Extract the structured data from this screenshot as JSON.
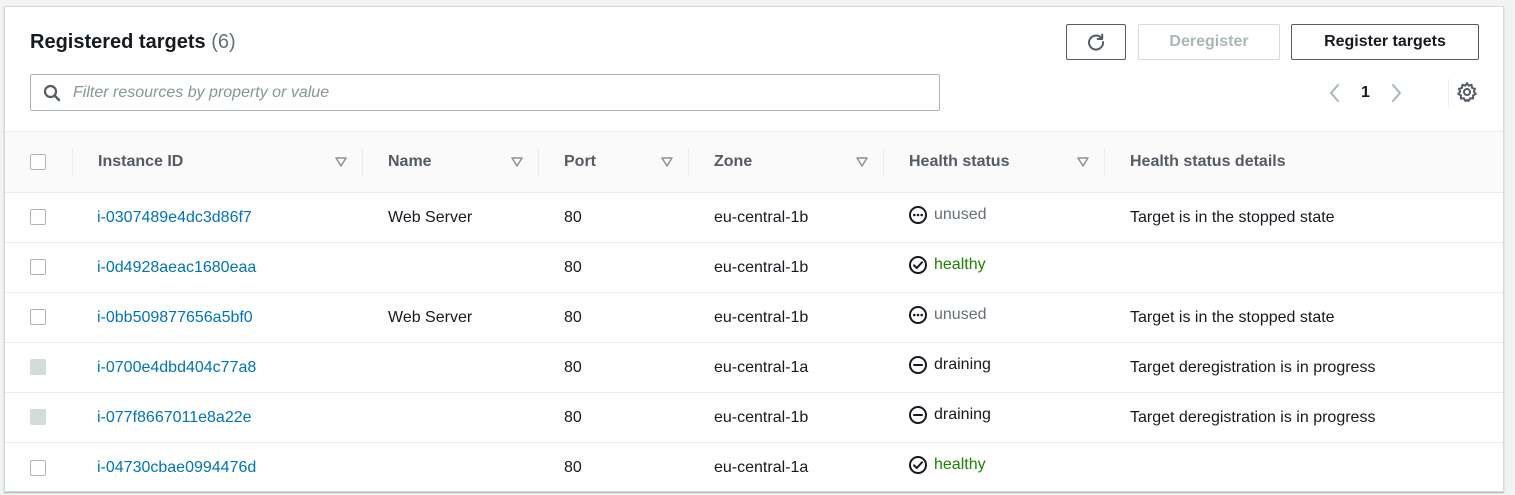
{
  "header": {
    "title": "Registered targets",
    "count": "(6)",
    "deregister_label": "Deregister",
    "register_label": "Register targets"
  },
  "search": {
    "placeholder": "Filter resources by property or value"
  },
  "pagination": {
    "current_page": "1"
  },
  "columns": [
    {
      "label": "Instance ID"
    },
    {
      "label": "Name"
    },
    {
      "label": "Port"
    },
    {
      "label": "Zone"
    },
    {
      "label": "Health status"
    },
    {
      "label": "Health status details"
    }
  ],
  "rows": [
    {
      "instance_id": "i-0307489e4dc3d86f7",
      "name": "Web Server",
      "port": "80",
      "zone": "eu-central-1b",
      "health": "unused",
      "details": "Target is in the stopped state",
      "selectable": true
    },
    {
      "instance_id": "i-0d4928aeac1680eaa",
      "name": "",
      "port": "80",
      "zone": "eu-central-1b",
      "health": "healthy",
      "details": "",
      "selectable": true
    },
    {
      "instance_id": "i-0bb509877656a5bf0",
      "name": "Web Server",
      "port": "80",
      "zone": "eu-central-1b",
      "health": "unused",
      "details": "Target is in the stopped state",
      "selectable": true
    },
    {
      "instance_id": "i-0700e4dbd404c77a8",
      "name": "",
      "port": "80",
      "zone": "eu-central-1a",
      "health": "draining",
      "details": "Target deregistration is in progress",
      "selectable": false
    },
    {
      "instance_id": "i-077f8667011e8a22e",
      "name": "",
      "port": "80",
      "zone": "eu-central-1b",
      "health": "draining",
      "details": "Target deregistration is in progress",
      "selectable": false
    },
    {
      "instance_id": "i-04730cbae0994476d",
      "name": "",
      "port": "80",
      "zone": "eu-central-1a",
      "health": "healthy",
      "details": "",
      "selectable": true
    }
  ],
  "colors": {
    "link": "#0073bb",
    "healthy": "#1d8102",
    "unused": "#687078",
    "draining": "#16191f"
  },
  "icons": {
    "refresh": "refresh-icon",
    "search": "search-icon",
    "prev": "chevron-left-icon",
    "next": "chevron-right-icon",
    "settings": "gear-icon",
    "sort": "sort-caret-icon",
    "unused": "ellipsis-circle-icon",
    "healthy": "check-circle-icon",
    "draining": "minus-circle-icon"
  }
}
